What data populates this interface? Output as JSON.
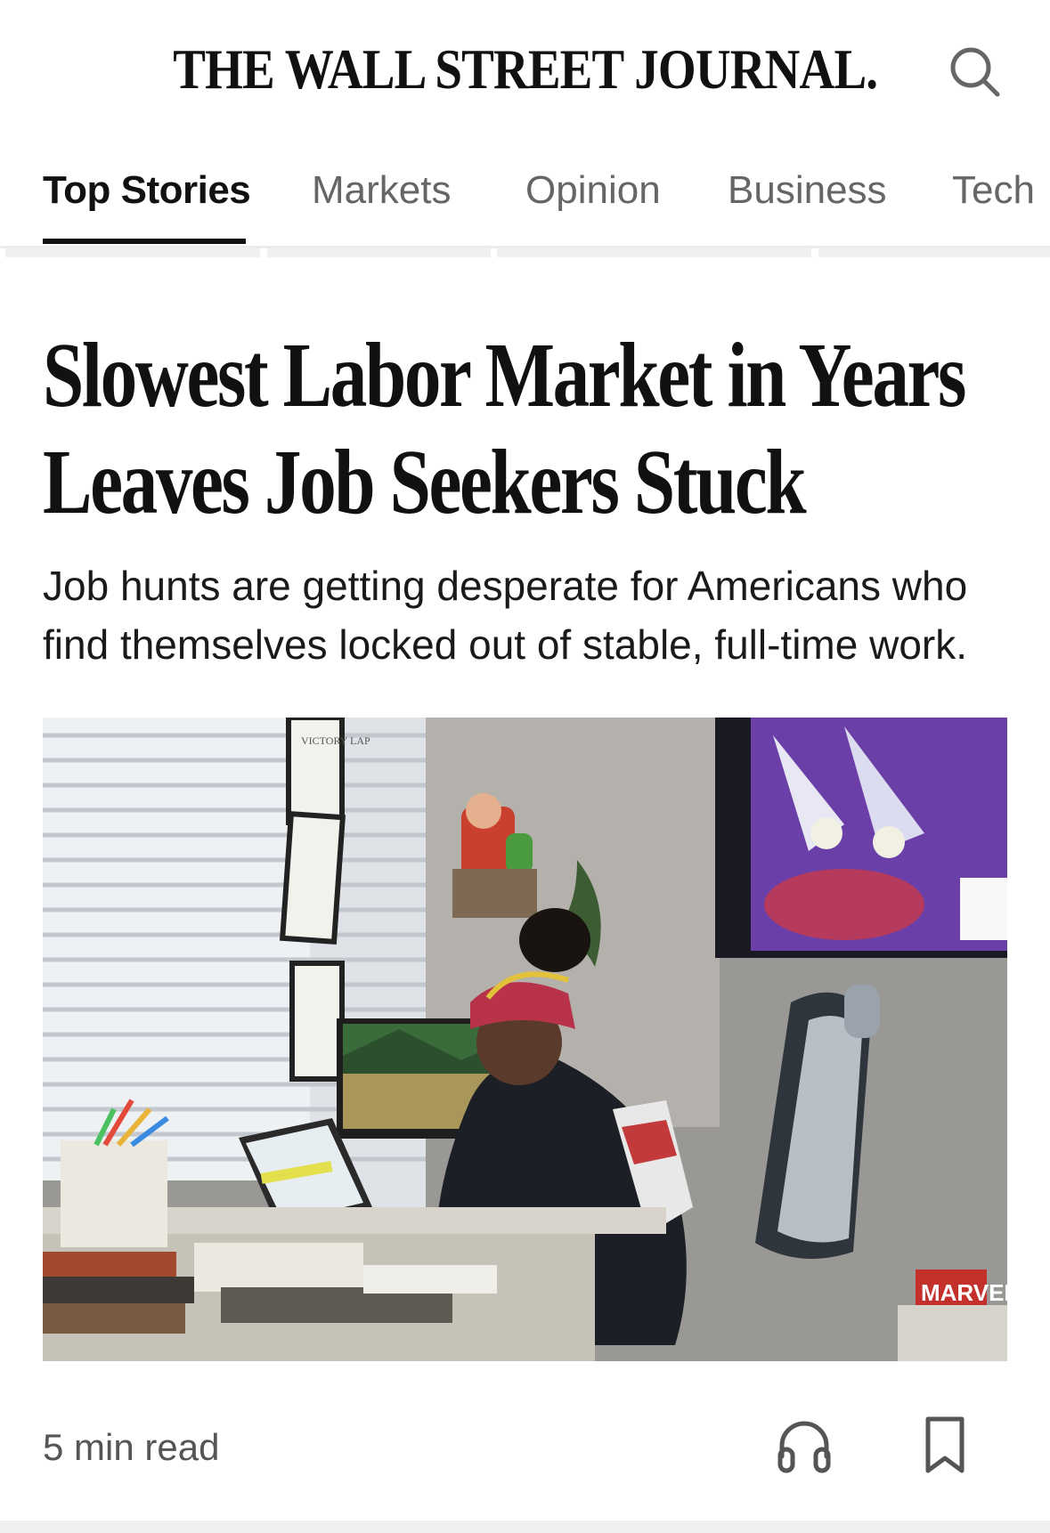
{
  "header": {
    "masthead": "THE WALL STREET JOURNAL.",
    "search_icon": "search-icon"
  },
  "tabs": [
    {
      "label": "Top Stories",
      "active": true
    },
    {
      "label": "Markets",
      "active": false
    },
    {
      "label": "Opinion",
      "active": false
    },
    {
      "label": "Business",
      "active": false
    },
    {
      "label": "Tech",
      "active": false
    }
  ],
  "article": {
    "headline": "Slowest Labor Market in Years Leaves Job Seekers Stuck",
    "dek": "Job hunts are getting desperate for Americans who find themselves locked out of stable, full-time work.",
    "photo_texts": {
      "sign": "VICTORY LAP",
      "marvel": "MARVEL"
    },
    "read_time": "5 min read",
    "listen_icon": "headphones-icon",
    "bookmark_icon": "bookmark-icon"
  },
  "colors": {
    "text": "#111111",
    "muted": "#666666",
    "divider": "#ececec"
  }
}
